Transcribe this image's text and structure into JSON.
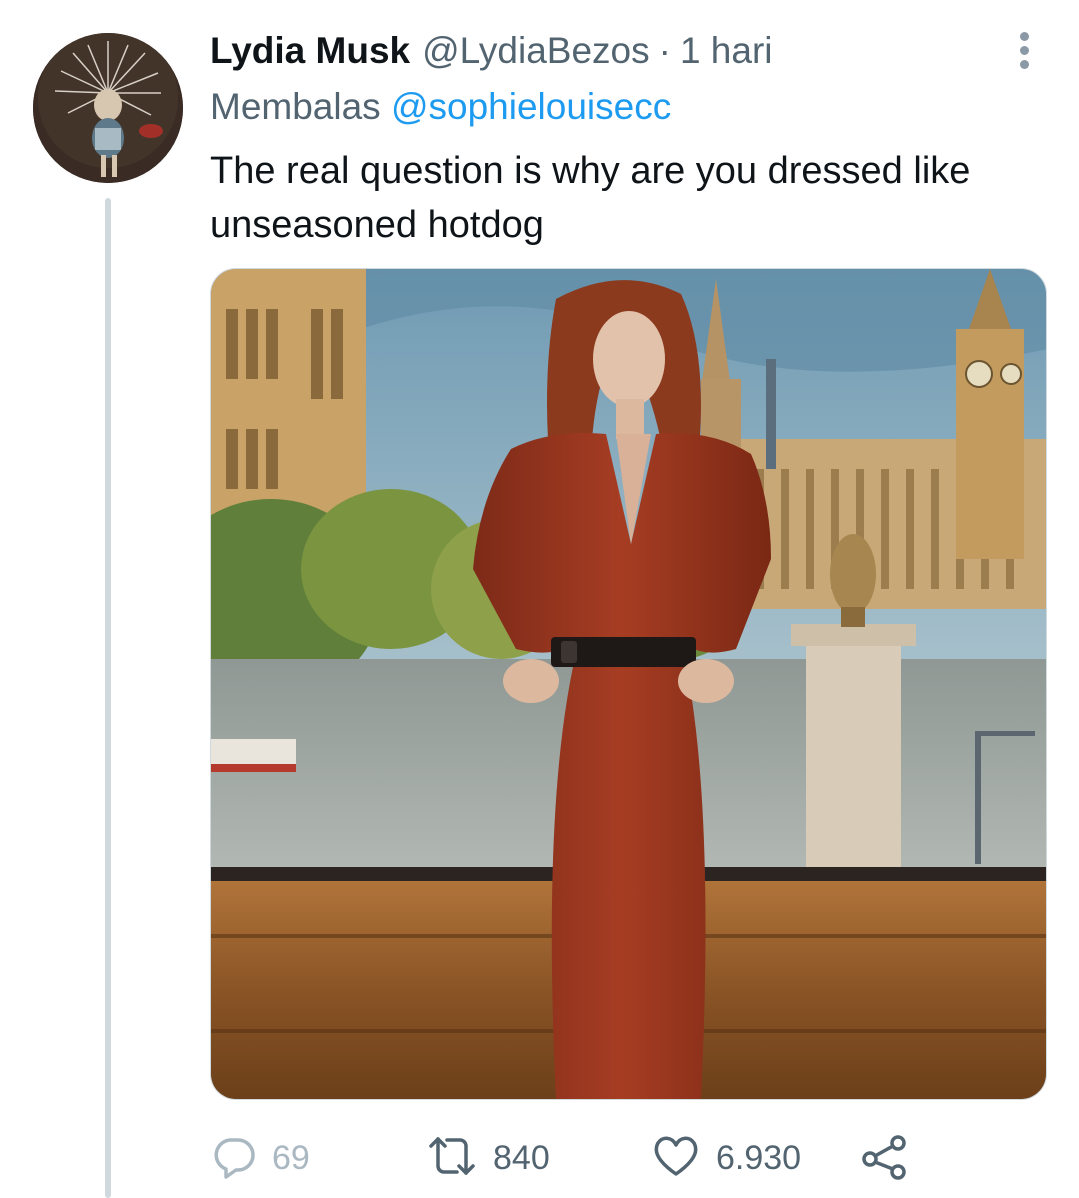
{
  "tweet": {
    "author_name": "Lydia Musk",
    "author_handle": "@LydiaBezos",
    "separator": "·",
    "timestamp": "1 hari",
    "reply_prefix": "Membalas",
    "reply_mention": "@sophielouisecc",
    "text": "The real question is why are you dressed like unseasoned hotdog"
  },
  "actions": {
    "replies": "69",
    "retweets": "840",
    "likes": "6.930"
  },
  "icons": {
    "more": "more-options-icon",
    "reply": "reply-icon",
    "retweet": "retweet-icon",
    "like": "heart-icon",
    "share": "share-icon"
  },
  "colors": {
    "text": "#0f1419",
    "secondary": "#536471",
    "mention": "#1d9bf0",
    "thread_line": "#cfd9de"
  }
}
